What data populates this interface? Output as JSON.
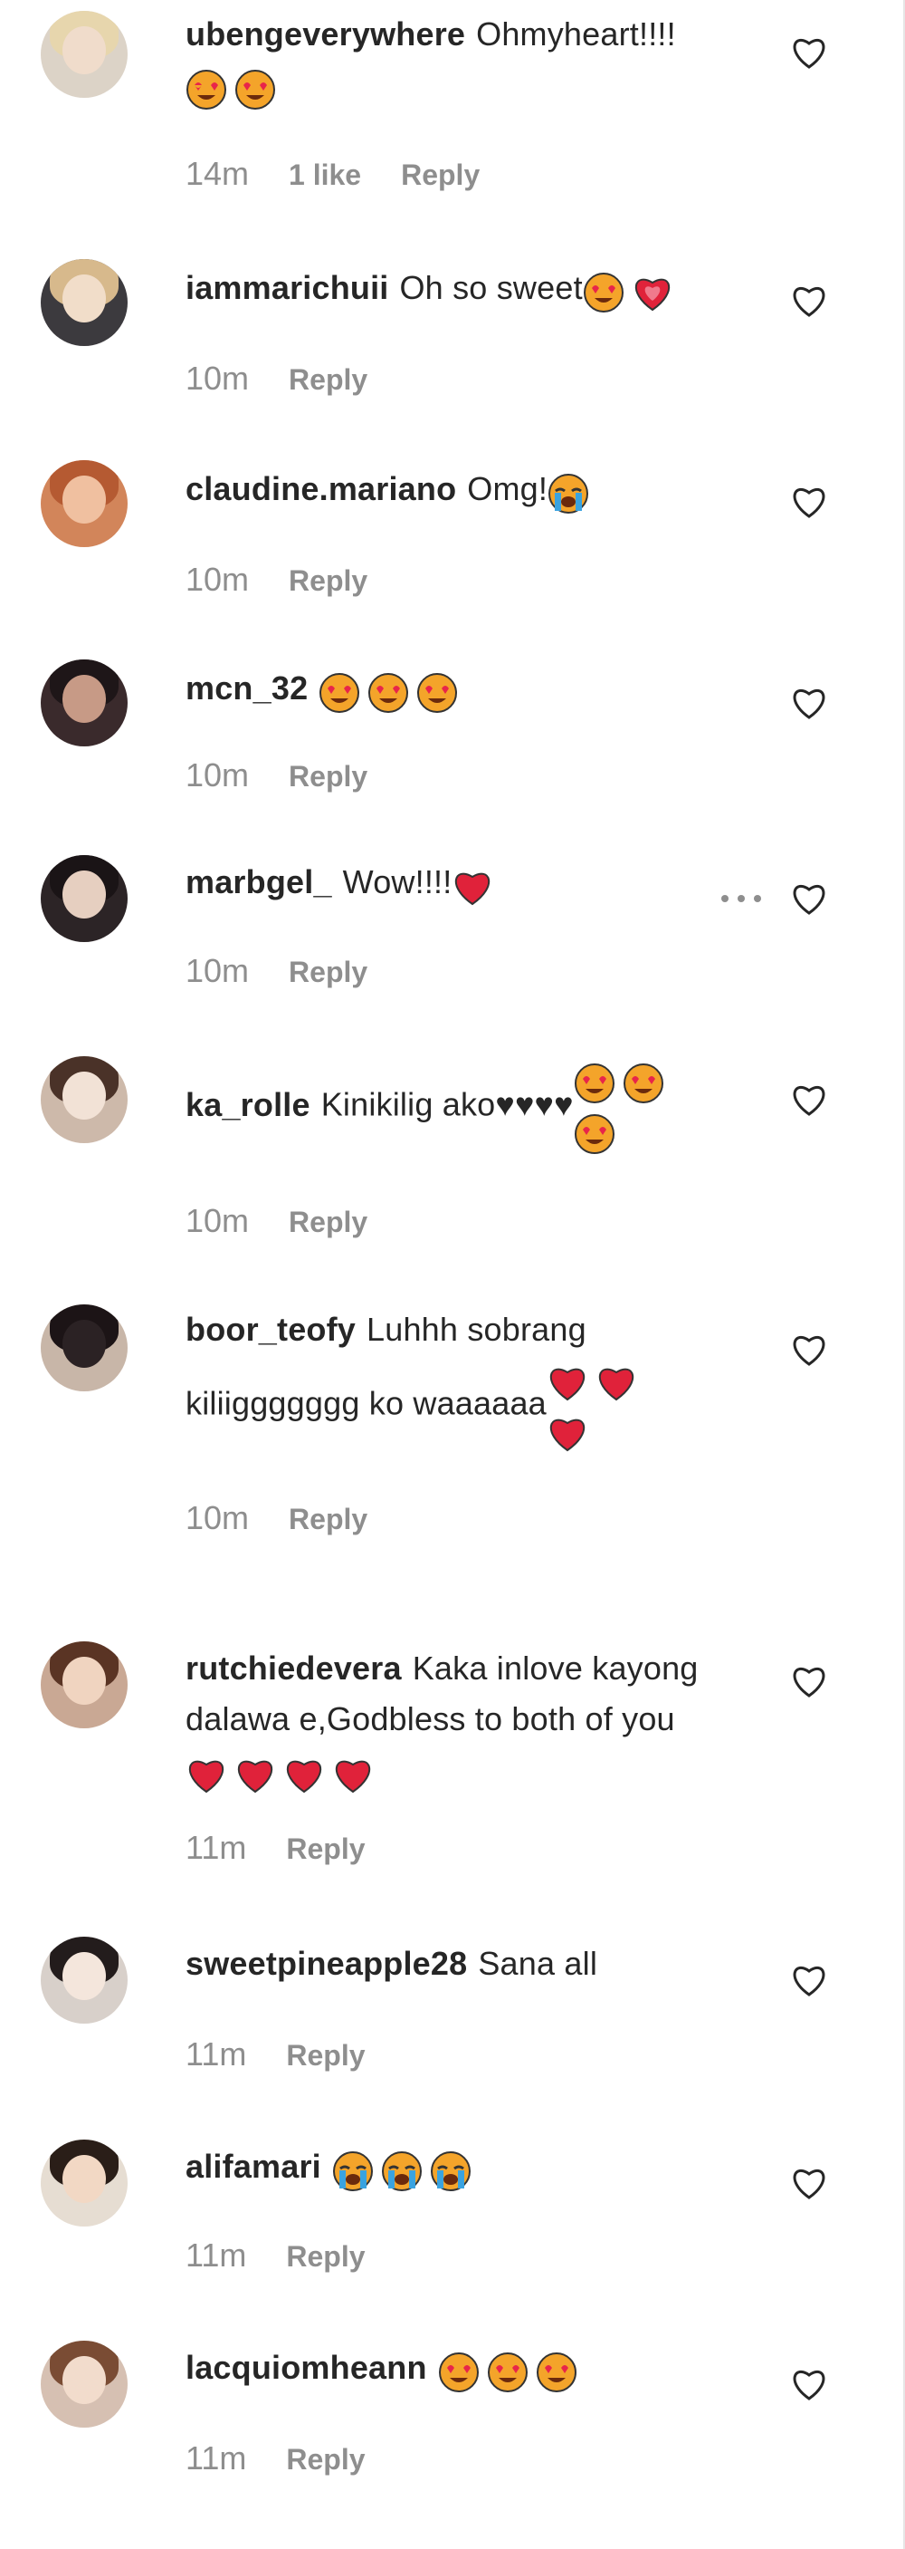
{
  "comments": [
    {
      "username": "ubengeverywhere",
      "text": "Ohmyheart!!!!",
      "emojis": [
        "heart-eyes",
        "heart-eyes"
      ],
      "time": "14m",
      "likes": "1 like",
      "reply": "Reply"
    },
    {
      "username": "iammarichuii",
      "text": "Oh so sweet",
      "emojis": [
        "heart-eyes",
        "growing-heart"
      ],
      "time": "10m",
      "likes": "",
      "reply": "Reply"
    },
    {
      "username": "claudine.mariano",
      "text": "Omg!",
      "emojis": [
        "crying"
      ],
      "time": "10m",
      "likes": "",
      "reply": "Reply"
    },
    {
      "username": "mcn_32",
      "text": "",
      "emojis": [
        "heart-eyes",
        "heart-eyes",
        "heart-eyes"
      ],
      "time": "10m",
      "likes": "",
      "reply": "Reply"
    },
    {
      "username": "marbgel_",
      "text": "Wow!!!!",
      "emojis": [
        "red-heart"
      ],
      "time": "10m",
      "likes": "",
      "reply": "Reply"
    },
    {
      "username": "ka_rolle",
      "text": "Kinikilig ako♥♥♥♥",
      "emojis": [
        "heart-eyes",
        "heart-eyes",
        "heart-eyes"
      ],
      "time": "10m",
      "likes": "",
      "reply": "Reply"
    },
    {
      "username": "boor_teofy",
      "text": "Luhhh sobrang kiliiggggggg ko waaaaaa",
      "emojis": [
        "red-heart",
        "red-heart",
        "red-heart"
      ],
      "time": "10m",
      "likes": "",
      "reply": "Reply"
    },
    {
      "username": "rutchiedevera",
      "text": "Kaka inlove kayong dalawa e,Godbless to both of you",
      "emojis": [
        "red-heart",
        "red-heart",
        "red-heart",
        "red-heart"
      ],
      "time": "11m",
      "likes": "",
      "reply": "Reply"
    },
    {
      "username": "sweetpineapple28",
      "text": "Sana all",
      "emojis": [],
      "time": "11m",
      "likes": "",
      "reply": "Reply"
    },
    {
      "username": "alifamari",
      "text": "",
      "emojis": [
        "crying",
        "crying",
        "crying"
      ],
      "time": "11m",
      "likes": "",
      "reply": "Reply"
    },
    {
      "username": "lacquiomheann",
      "text": "",
      "emojis": [
        "heart-eyes",
        "heart-eyes",
        "heart-eyes"
      ],
      "time": "11m",
      "likes": "",
      "reply": "Reply"
    }
  ],
  "colors": {
    "heart_eyes_face": "#f4a42a",
    "heart_eyes_hearts": "#e8254a",
    "red_heart": "#e0223a",
    "crying_face": "#f4a42a",
    "crying_tears": "#3aa3e0",
    "muted": "#8e8e8e"
  }
}
